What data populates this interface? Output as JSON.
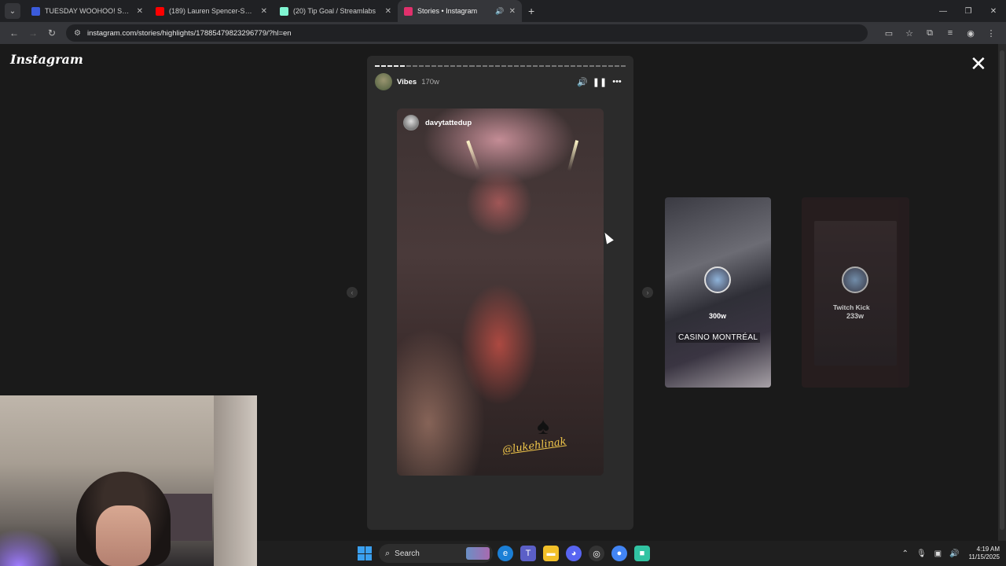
{
  "browser": {
    "tabs": [
      {
        "title": "TUESDAY WOOHOO! STREAM",
        "favicon_color": "#3b5bdb",
        "active": false
      },
      {
        "title": "(189) Lauren Spencer-Smith - F",
        "favicon_color": "#ff0000",
        "active": false
      },
      {
        "title": "(20) Tip Goal / Streamlabs",
        "favicon_color": "#80f5d2",
        "active": false
      },
      {
        "title": "Stories • Instagram",
        "favicon_color": "#e1306c",
        "active": true
      }
    ],
    "url": "instagram.com/stories/highlights/17885479823296779/?hl=en"
  },
  "instagram": {
    "logo": "Instagram",
    "story": {
      "highlight_name": "Vibes",
      "time": "170w",
      "reel_username": "davytattedup",
      "reel_tag": "@lukehlinak"
    },
    "previews": [
      {
        "time": "300w",
        "location": "CASINO MONTRÉAL"
      },
      {
        "time": "233w",
        "title": "Twitch Kick"
      }
    ]
  },
  "taskbar": {
    "search_placeholder": "Search",
    "time": "4:19 AM",
    "date": "11/15/2025"
  }
}
